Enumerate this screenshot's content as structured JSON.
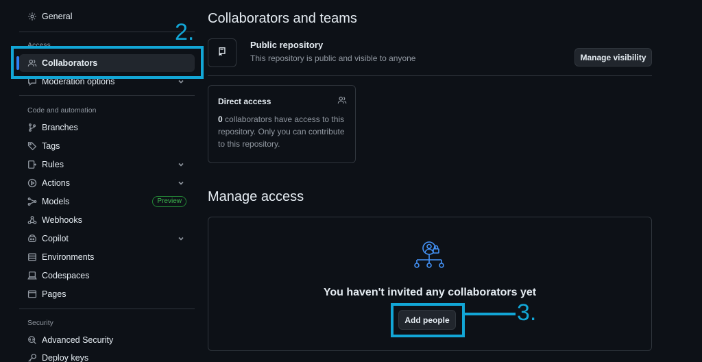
{
  "sidebar": {
    "general": "General",
    "access_label": "Access",
    "collaborators": "Collaborators",
    "moderation": "Moderation options",
    "code_label": "Code and automation",
    "branches": "Branches",
    "tags": "Tags",
    "rules": "Rules",
    "actions": "Actions",
    "models": "Models",
    "models_badge": "Preview",
    "webhooks": "Webhooks",
    "copilot": "Copilot",
    "environments": "Environments",
    "codespaces": "Codespaces",
    "pages": "Pages",
    "security_label": "Security",
    "advanced_security": "Advanced Security",
    "deploy_keys": "Deploy keys"
  },
  "annotations": {
    "step2": "2.",
    "step3": "3."
  },
  "main": {
    "title": "Collaborators and teams",
    "repo_title": "Public repository",
    "repo_desc": "This repository is public and visible to anyone",
    "manage_visibility": "Manage visibility",
    "direct_access_title": "Direct access",
    "direct_access_count": "0",
    "direct_access_text": " collaborators have access to this repository. Only you can contribute to this repository.",
    "manage_access_title": "Manage access",
    "empty_title": "You haven't invited any collaborators yet",
    "add_people": "Add people"
  },
  "colors": {
    "accent": "#2f81f7",
    "annotation": "#12a6d6",
    "background": "#0d1117"
  }
}
